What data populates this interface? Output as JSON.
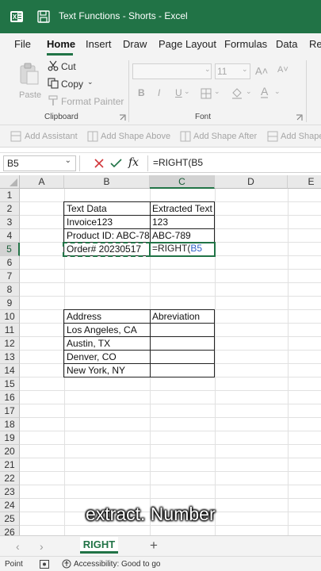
{
  "title": {
    "text": "Text Functions - Shorts  -  Excel"
  },
  "menu": {
    "tabs": [
      {
        "label": "File"
      },
      {
        "label": "Home"
      },
      {
        "label": "Insert"
      },
      {
        "label": "Draw"
      },
      {
        "label": "Page Layout"
      },
      {
        "label": "Formulas"
      },
      {
        "label": "Data"
      },
      {
        "label": "Re"
      }
    ],
    "active": "Home"
  },
  "ribbon": {
    "paste": "Paste",
    "cut": "Cut",
    "copy": "Copy",
    "format_painter": "Format Painter",
    "clipboard_label": "Clipboard",
    "font_label": "Font",
    "font_size": "11",
    "bold": "B",
    "italic": "I",
    "underline": "U"
  },
  "shapebar": {
    "add_assistant": "Add Assistant",
    "add_shape_above": "Add Shape Above",
    "add_shape_after": "Add Shape After",
    "add_shape": "Add Shape"
  },
  "formula_bar": {
    "name_box": "B5",
    "fx": "fx",
    "formula": "=RIGHT(B5"
  },
  "grid": {
    "columns": [
      "A",
      "B",
      "C",
      "D",
      "E"
    ],
    "rows": [
      "1",
      "2",
      "3",
      "4",
      "5",
      "6",
      "7",
      "8",
      "9",
      "10",
      "11",
      "12",
      "13",
      "14",
      "15",
      "16",
      "17",
      "18",
      "19",
      "20",
      "21",
      "22",
      "23",
      "24",
      "25",
      "26"
    ],
    "table1": {
      "header": [
        "Text Data",
        "Extracted Text"
      ],
      "rows": [
        [
          "Invoice123",
          "123"
        ],
        [
          "Product ID: ABC-789",
          "ABC-789"
        ],
        [
          "Order# 20230517",
          ""
        ]
      ],
      "editing_prefix": "=RIGHT(",
      "editing_ref": "B5"
    },
    "table2": {
      "header": [
        "Address",
        "Abreviation"
      ],
      "rows": [
        [
          "Los Angeles, CA",
          ""
        ],
        [
          "Austin, TX",
          ""
        ],
        [
          "Denver, CO",
          ""
        ],
        [
          "New York, NY",
          ""
        ]
      ]
    },
    "caption": "extract. Number"
  },
  "sheets": {
    "tabs": [
      {
        "label": "RIGHT"
      }
    ],
    "add": "+"
  },
  "status": {
    "mode": "Point",
    "accessibility": "Accessibility: Good to go"
  },
  "colors": {
    "accent": "#217346",
    "reference_blue": "#2f62c7"
  }
}
